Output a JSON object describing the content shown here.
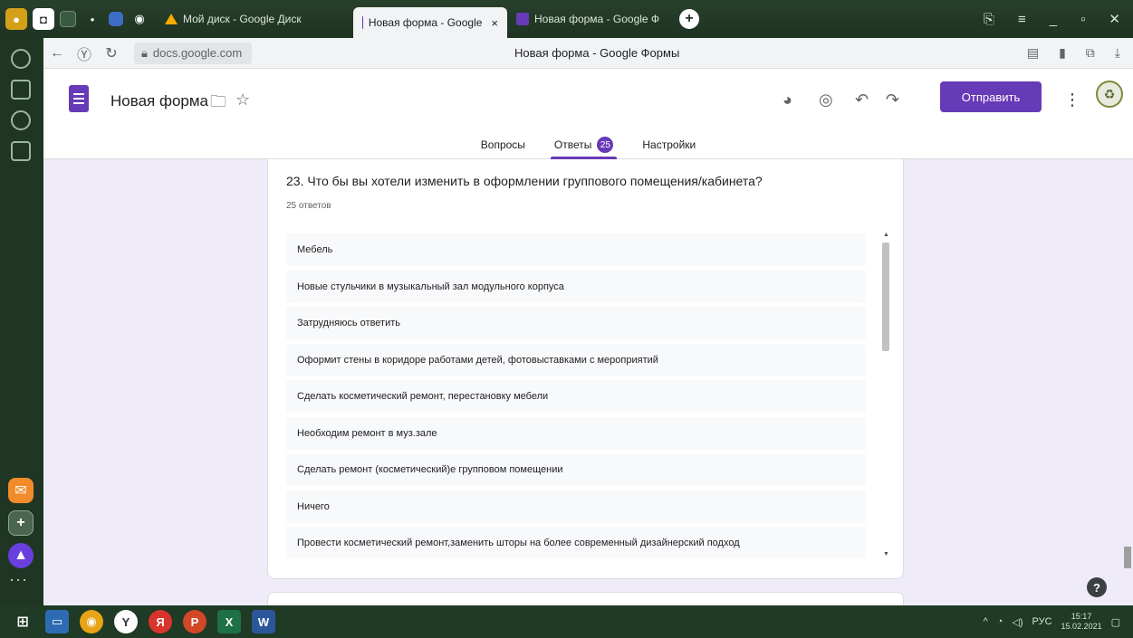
{
  "browser": {
    "tabs": [
      {
        "label": "Мой диск - Google Диск",
        "icon": "drive-icon"
      },
      {
        "label": "Новая форма - Google",
        "icon": "forms-icon",
        "active": true
      },
      {
        "label": "Новая форма - Google Ф",
        "icon": "forms-icon"
      }
    ],
    "tab_close": "×",
    "new_tab": "+",
    "url": "docs.google.com",
    "page_title": "Новая форма - Google Формы"
  },
  "form": {
    "name": "Новая форма",
    "send_label": "Отправить",
    "tabs": [
      {
        "label": "Вопросы"
      },
      {
        "label": "Ответы",
        "badge": "25"
      },
      {
        "label": "Настройки"
      }
    ],
    "accent_color": "#673ab7"
  },
  "question": {
    "title": "23. Что бы вы хотели изменить в оформлении группового помещения/кабинета?",
    "count_label": "25 ответов",
    "answers": [
      "Мебель",
      "Новые стульчики в музыкальный зал модульного корпуса",
      "Затрудняюсь ответить",
      "Оформит стены в коридоре работами детей, фотовыставками с мероприятий",
      "Сделать косметический ремонт, перестановку мебели",
      "Необходим ремонт в муз.зале",
      "Сделать ремонт (косметический)е групповом помещении",
      "Ничего",
      "Провести косметический ремонт,заменить шторы на более современный дизайнерский подход"
    ]
  },
  "help_label": "?",
  "taskbar": {
    "lang": "РУС",
    "time": "15:17",
    "date": "15.02.2021"
  }
}
